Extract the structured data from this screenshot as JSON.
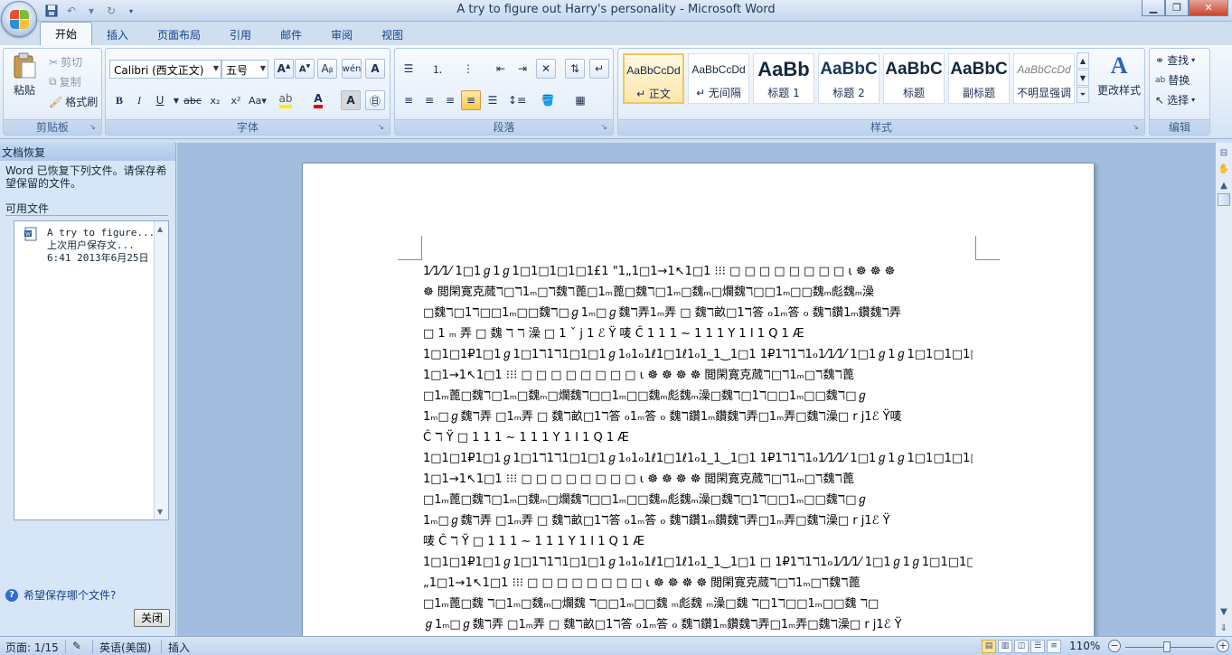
{
  "window": {
    "title": "A try to figure out Harry's personality - Microsoft Word"
  },
  "tabs": [
    "开始",
    "插入",
    "页面布局",
    "引用",
    "邮件",
    "审阅",
    "视图"
  ],
  "clipboard": {
    "paste": "粘贴",
    "cut": "剪切",
    "copy": "复制",
    "format_painter": "格式刷",
    "label": "剪贴板"
  },
  "font": {
    "name": "Calibri (西文正文)",
    "size": "五号",
    "label": "字体"
  },
  "paragraph": {
    "label": "段落"
  },
  "styles": {
    "label": "样式",
    "items": [
      {
        "sample": "AaBbCcDd",
        "name": "↵ 正文"
      },
      {
        "sample": "AaBbCcDd",
        "name": "↵ 无间隔"
      },
      {
        "sample": "AaBb",
        "name": "标题 1"
      },
      {
        "sample": "AaBbC",
        "name": "标题 2"
      },
      {
        "sample": "AaBbC",
        "name": "标题"
      },
      {
        "sample": "AaBbC",
        "name": "副标题"
      },
      {
        "sample": "AaBbCcDd",
        "name": "不明显强调"
      }
    ],
    "change_styles": "更改样式"
  },
  "editing": {
    "find": "查找",
    "replace": "替换",
    "select": "选择",
    "label": "编辑"
  },
  "recovery": {
    "header": "文档恢复",
    "message": "Word 已恢复下列文件。请保存希望保留的文件。",
    "available": "可用文件",
    "file_lines": [
      "A try to figure...",
      "上次用户保存文...",
      "6:41 2013年6月25日"
    ],
    "help": "希望保存哪个文件?",
    "close": "关闭"
  },
  "document": {
    "lines": [
      "1⁄1⁄1⁄ 1□1ℊ1ℊ1□1□1□1□1£1 \"1„1□1→1↖1□1       ⁝⁝⁝      □ □ □ □ □ □ □ □ ⍳ ☸ ☸ ☸",
      "☸ 閲閑寛克蒇ℸ□ℸ1ₘ□ℸ魏ℸ蓖□1ₘ蓖□魏ℸ□1ₘ□魏ₘ□爛魏ℸ□□1ₘ□□魏ₘ彪魏ₘ澡",
      "□魏ℸ□1ℸ□□1ₘ□□魏ℸ□ℊ1ₘ□ℊ魏ℸ弄1ₘ弄 □ 魏ℸ畝□1ℸ答 ℴ1ₘ答 ℴ 魏ℸ鑽1ₘ鑽魏ℸ弄",
      "□ 1 ₘ 弄  □  魏  ℸ ℸ 澡  □  1 ˇ  j 1 ℰ   Ÿ   唛   Ĉ    1 1 1 ~ 1    1    1 Y 1 I 1 Q 1 Æ",
      "1□1□1₽1□1ℊ1□1ℸ1ℸ1□1□1ℊ1ℴ1ℴ1ℓ1□1ℓ1ℴ1_1‿1□1 1₽1ℸ1ℸ1ℴ1⁄1⁄1⁄ 1□1ℊ1ℊ1□1□1□1□1£1\"1„",
      "1□1→1↖1□1         ⁝⁝⁝       □ □ □ □ □ □ □ □ ⍳ ☸ ☸ ☸ ☸ 閲閑寛克蒇ℸ□ℸ1ₘ□ℸ魏ℸ蓖",
      "□1ₘ蓖□魏ℸ□1ₘ□魏ₘ□爛魏ℸ□□1ₘ□□魏ₘ彪魏ₘ澡□魏ℸ□1ℸ□□1ₘ□□魏ℸ□ℊ",
      "1ₘ□ℊ魏ℸ弄 □1ₘ弄 □ 魏ℸ畝□1ℸ答 ℴ1ₘ答 ℴ 魏ℸ鑽1ₘ鑽魏ℸ弄□1ₘ弄□魏ℸ澡□ r j1ℰ  Ÿ唛",
      "Ĉ   ℸ          Ÿ   □     1    1    1     ~    1         1          1   Y   1    I    1   Q    1   Æ",
      "1□1□1₽1□1ℊ1□1ℸ1ℸ1□1□1ℊ1ℴ1ℴ1ℓ1□1ℓ1ℴ1_1‿1□1 1₽1ℸ1ℸ1ℴ1⁄1⁄1⁄ 1□1ℊ1ℊ1□1□1□1□1£1\"1„",
      "1□1→1↖1□1         ⁝⁝⁝       □ □ □ □ □ □ □ □ ⍳ ☸ ☸ ☸ ☸ 閲閑寛克蒇ℸ□ℸ1ₘ□ℸ魏ℸ蓖",
      "□1ₘ蓖□魏ℸ□1ₘ□魏ₘ□爛魏ℸ□□1ₘ□□魏ₘ彪魏ₘ澡□魏ℸ□1ℸ□□1ₘ□□魏ℸ□ℊ",
      "1ₘ□ℊ魏ℸ弄 □1ₘ弄 □  魏ℸ畝□1ℸ答 ℴ1ₘ答 ℴ 魏ℸ鑽1ₘ鑽魏ℸ弄□1ₘ弄□魏ℸ澡□ r j1ℰ   Ÿ",
      "唛    Ĉ    ℸ          Ÿ   □     1    1    1     ~    1         1          1   Y   1    I    1   Q    1   Æ",
      "1□1□1₽1□1ℊ1□1ℸ1ℸ1□1□1ℊ1ℴ1ℴ1ℓ1□1ℓ1ℴ1_1‿1□1 □ 1₽1ℸ1ℸ1ℴ1⁄1⁄1⁄ 1□1ℊ1ℊ1□1□1□1□1£1\"1",
      "„1□1→1↖1□1        ⁝⁝⁝       □ □ □ □ □ □ □ □ ⍳ ☸ ☸ ☸ ☸ 閲閑寛克蒇ℸ□ℸ1ₘ□ℸ魏ℸ蓖",
      "□1ₘ蓖□魏 ℸ□1ₘ□魏ₘ□爛魏 ℸ□□1ₘ□□魏 ₘ彪魏 ₘ澡□魏 ℸ□1ℸ□□1ₘ□□魏 ℸ□",
      "ℊ1ₘ□ℊ魏ℸ弄 □1ₘ弄 □ 魏ℸ畝□1ℸ答 ℴ1ₘ答 ℴ 魏ℸ鑽1ₘ鑽魏ℸ弄□1ₘ弄□魏ℸ澡□ r j1ℰ   Ÿ"
    ]
  },
  "status": {
    "page": "页面: 1/15",
    "language": "英语(美国)",
    "mode": "插入",
    "zoom": "110%"
  }
}
